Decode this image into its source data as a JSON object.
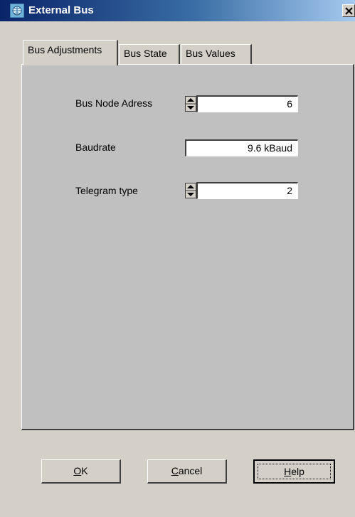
{
  "window": {
    "title": "External Bus",
    "close_label": "x"
  },
  "tabs": [
    {
      "label": "Bus Adjustments",
      "active": true
    },
    {
      "label": "Bus State",
      "active": false
    },
    {
      "label": "Bus Values",
      "active": false
    }
  ],
  "fields": {
    "bus_node_address": {
      "label": "Bus Node Adress",
      "value": "6"
    },
    "baudrate": {
      "label": "Baudrate",
      "value": "9.6 kBaud"
    },
    "telegram_type": {
      "label": "Telegram type",
      "value": "2"
    }
  },
  "buttons": {
    "ok": {
      "mnemonic": "O",
      "rest": "K"
    },
    "cancel": {
      "mnemonic": "C",
      "rest": "ancel"
    },
    "help": {
      "mnemonic": "H",
      "rest": "elp"
    }
  },
  "icons": {
    "app": "network-globe-icon",
    "close": "close-icon",
    "spin": "spin-up-down-icon"
  },
  "colors": {
    "titlebar_start": "#0a246a",
    "titlebar_end": "#a6caf0",
    "dialog_bg": "#d4d0c8",
    "panel_bg": "#c0c0c0"
  }
}
